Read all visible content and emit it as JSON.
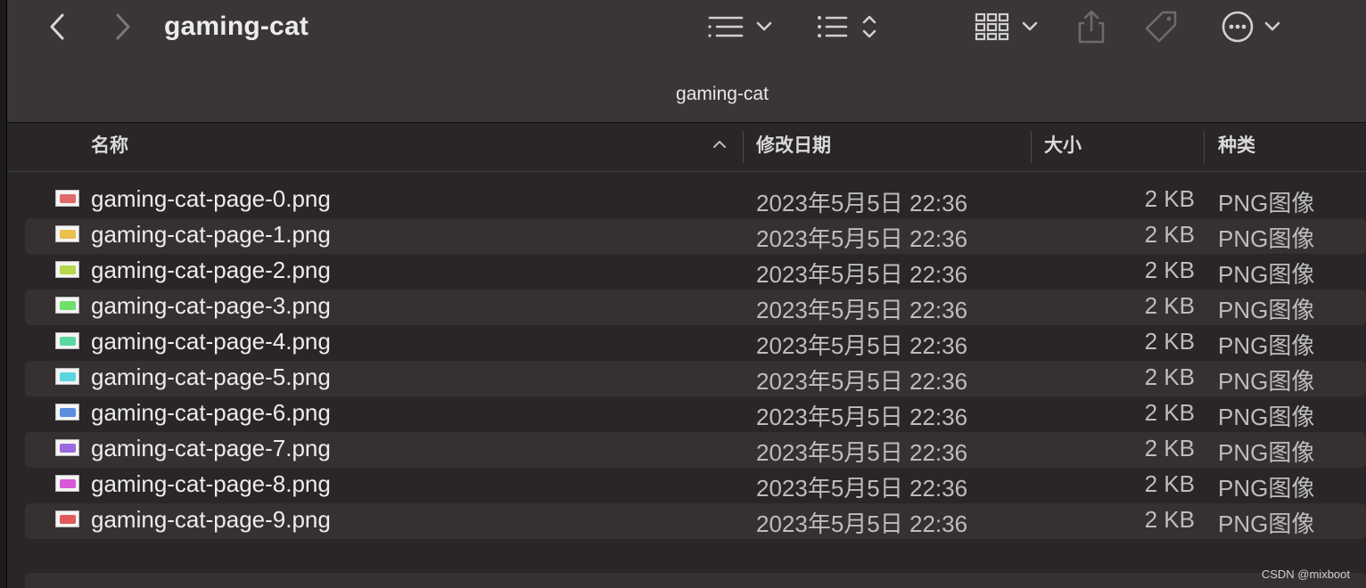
{
  "toolbar": {
    "title": "gaming-cat",
    "path_title": "gaming-cat",
    "icons": [
      "back-icon",
      "forward-icon",
      "list-view-icon",
      "chevron-down-icon",
      "group-icon",
      "sort-updown-icon",
      "gallery-view-icon",
      "share-icon",
      "tag-icon",
      "more-icon"
    ]
  },
  "columns": {
    "name": "名称",
    "modified": "修改日期",
    "size": "大小",
    "kind": "种类"
  },
  "files": [
    {
      "name": "gaming-cat-page-0.png",
      "modified": "2023年5月5日 22:36",
      "size": "2 KB",
      "kind": "PNG图像",
      "thumb_color": "#e06a6a"
    },
    {
      "name": "gaming-cat-page-1.png",
      "modified": "2023年5月5日 22:36",
      "size": "2 KB",
      "kind": "PNG图像",
      "thumb_color": "#e8c24a"
    },
    {
      "name": "gaming-cat-page-2.png",
      "modified": "2023年5月5日 22:36",
      "size": "2 KB",
      "kind": "PNG图像",
      "thumb_color": "#b4d84a"
    },
    {
      "name": "gaming-cat-page-3.png",
      "modified": "2023年5月5日 22:36",
      "size": "2 KB",
      "kind": "PNG图像",
      "thumb_color": "#6ee06a"
    },
    {
      "name": "gaming-cat-page-4.png",
      "modified": "2023年5月5日 22:36",
      "size": "2 KB",
      "kind": "PNG图像",
      "thumb_color": "#5ad8a0"
    },
    {
      "name": "gaming-cat-page-5.png",
      "modified": "2023年5月5日 22:36",
      "size": "2 KB",
      "kind": "PNG图像",
      "thumb_color": "#5ad6e0"
    },
    {
      "name": "gaming-cat-page-6.png",
      "modified": "2023年5月5日 22:36",
      "size": "2 KB",
      "kind": "PNG图像",
      "thumb_color": "#5a8ee0"
    },
    {
      "name": "gaming-cat-page-7.png",
      "modified": "2023年5月5日 22:36",
      "size": "2 KB",
      "kind": "PNG图像",
      "thumb_color": "#9a6ae0"
    },
    {
      "name": "gaming-cat-page-8.png",
      "modified": "2023年5月5日 22:36",
      "size": "2 KB",
      "kind": "PNG图像",
      "thumb_color": "#d85ad8"
    },
    {
      "name": "gaming-cat-page-9.png",
      "modified": "2023年5月5日 22:36",
      "size": "2 KB",
      "kind": "PNG图像",
      "thumb_color": "#e05a5a"
    }
  ],
  "watermark": "CSDN @mixboot"
}
